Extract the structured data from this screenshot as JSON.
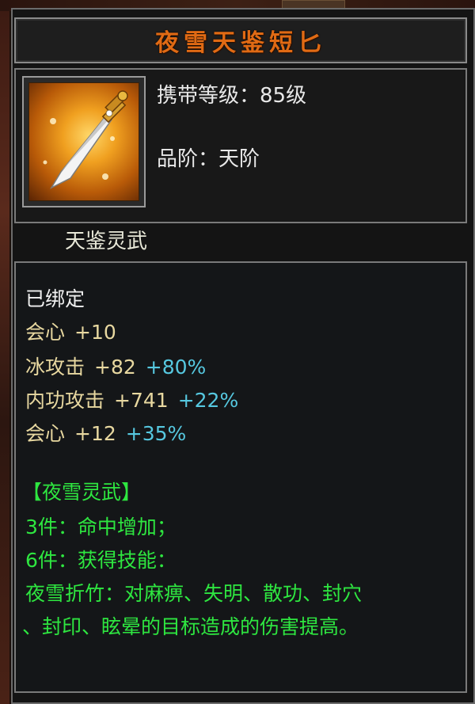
{
  "item": {
    "name": "夜雪天鉴短匕",
    "carry_level": "携带等级：85级",
    "grade": "品阶：天阶",
    "category": "天鉴灵武"
  },
  "stats": {
    "bound": "已绑定",
    "base": {
      "label": "会心",
      "value": "+10"
    },
    "lines": [
      {
        "label": "冰攻击",
        "value": "+82",
        "bonus": "+80%"
      },
      {
        "label": "内功攻击",
        "value": "+741",
        "bonus": "+22%"
      },
      {
        "label": "会心",
        "value": "+12",
        "bonus": "+35%"
      }
    ]
  },
  "set": {
    "title": "【夜雪灵武】",
    "pieces3": "3件：命中增加；",
    "pieces6": "6件：获得技能：",
    "skill_line1": "夜雪折竹：对麻痹、失明、散功、封穴",
    "skill_line2": "、封印、眩晕的目标造成的伤害提高。"
  },
  "colors": {
    "title": "#e06a14",
    "stat_label": "#e8d8a0",
    "bonus": "#56c8e0",
    "set_text": "#2ee640"
  },
  "icon": "dagger-icon"
}
